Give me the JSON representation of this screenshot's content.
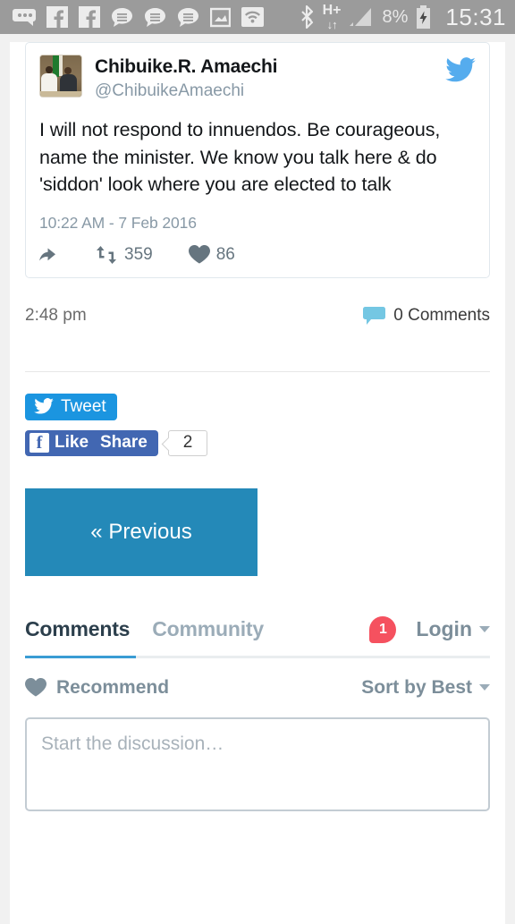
{
  "statusbar": {
    "icons": [
      {
        "name": "messaging-dots-icon"
      },
      {
        "name": "facebook-icon"
      },
      {
        "name": "facebook-icon"
      },
      {
        "name": "sms-message-icon"
      },
      {
        "name": "sms-message-icon"
      },
      {
        "name": "sms-message-icon"
      },
      {
        "name": "screenshot-image-icon"
      },
      {
        "name": "wifi-icon"
      }
    ],
    "bluetooth": "bluetooth-icon",
    "network_type": "H+",
    "data_arrows": "↓↑",
    "signal": "signal-bars-icon",
    "battery_percent": "8%",
    "battery_state": "charging",
    "time": "15:31"
  },
  "tweet": {
    "display_name": "Chibuike.R. Amaechi",
    "handle": "@ChibuikeAmaechi",
    "avatar_alt": "two-men-at-event-avatar",
    "brand_icon": "twitter-bird-icon",
    "text": "I will not respond to innuendos. Be courageous, name the minister. We know you talk here & do 'siddon' look where you are elected to talk",
    "date": "10:22 AM - 7 Feb 2016",
    "actions": {
      "reply_icon": "reply-arrow-icon",
      "retweet_icon": "retweet-icon",
      "retweet_count": "359",
      "like_icon": "heart-icon",
      "like_count": "86"
    }
  },
  "post_meta": {
    "time": "2:48 pm",
    "comments_icon": "comment-bubble-icon",
    "comments_label": "0 Comments"
  },
  "share": {
    "tweet_button": "Tweet",
    "tweet_icon": "twitter-bird-icon",
    "facebook_like": "Like",
    "facebook_icon": "facebook-f-icon",
    "facebook_share": "Share",
    "facebook_count": "2"
  },
  "pagination": {
    "previous_label": "« Previous"
  },
  "disqus": {
    "tab_comments": "Comments",
    "tab_community": "Community",
    "notification_count": "1",
    "login_label": "Login",
    "recommend_label": "Recommend",
    "recommend_icon": "heart-icon",
    "sort_label": "Sort by Best",
    "comment_placeholder": "Start the discussion…"
  },
  "colors": {
    "twitter_blue": "#1b95e0",
    "facebook_blue": "#4267b2",
    "previous_blue": "#2489b8",
    "disqus_accent": "#3a9cd4",
    "badge_red": "#f5515f",
    "statusbar_gray": "#9b9b9b"
  }
}
